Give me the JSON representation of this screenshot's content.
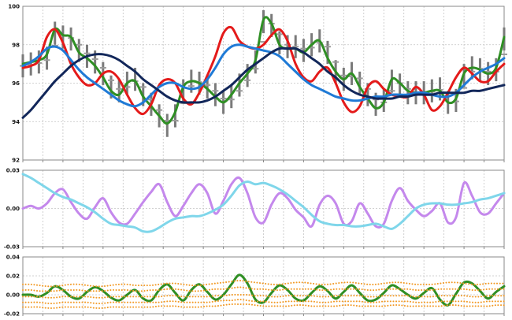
{
  "chart_data": [
    {
      "type": "line",
      "title": "",
      "xlabel": "",
      "ylabel": "",
      "ylim": [
        92,
        100
      ],
      "yticks": [
        92,
        94,
        96,
        98,
        100
      ],
      "ytick_labels": [
        "92",
        "94",
        "96",
        "98",
        "100"
      ],
      "grid": true,
      "x_points": 61,
      "series": [
        {
          "kind": "candles",
          "color": "#7a7a7a",
          "values": [
            96.9,
            97.0,
            97.1,
            97.3,
            98.6,
            98.4,
            98.3,
            97.7,
            97.4,
            97.1,
            96.5,
            95.8,
            95.6,
            96.0,
            96.2,
            95.4,
            94.9,
            94.3,
            93.8,
            94.3,
            95.6,
            96.1,
            96.0,
            95.8,
            95.4,
            95.0,
            95.3,
            95.9,
            96.4,
            97.1,
            99.2,
            99.0,
            98.1,
            97.9,
            97.9,
            97.7,
            98.0,
            98.2,
            97.6,
            96.6,
            96.2,
            96.5,
            96.0,
            95.4,
            94.9,
            95.1,
            96.1,
            95.9,
            95.5,
            95.5,
            95.5,
            95.6,
            95.7,
            95.0,
            95.1,
            96.4,
            96.8,
            96.7,
            96.5,
            96.7,
            98.3
          ],
          "spread": 0.6
        },
        {
          "color": "#2f8f24",
          "values": [
            97.0,
            97.1,
            97.2,
            97.5,
            98.8,
            98.5,
            98.4,
            97.6,
            97.3,
            96.9,
            96.3,
            95.6,
            95.4,
            96.0,
            96.1,
            95.3,
            94.8,
            94.3,
            93.9,
            94.5,
            95.8,
            96.1,
            96.0,
            95.7,
            95.3,
            95.0,
            95.4,
            96.0,
            96.5,
            97.2,
            99.3,
            99.1,
            98.0,
            97.8,
            97.8,
            97.6,
            98.0,
            98.2,
            97.3,
            96.6,
            96.2,
            96.5,
            95.8,
            95.2,
            94.7,
            95.0,
            96.2,
            96.0,
            95.6,
            95.5,
            95.5,
            95.6,
            95.6,
            95.0,
            95.2,
            96.5,
            96.8,
            96.7,
            96.5,
            96.8,
            98.4
          ]
        },
        {
          "color": "#e41a1a",
          "values": [
            96.8,
            96.9,
            97.2,
            98.4,
            98.8,
            98.1,
            97.0,
            96.3,
            95.9,
            96.0,
            96.5,
            96.6,
            96.2,
            95.4,
            94.7,
            94.4,
            94.9,
            95.9,
            96.2,
            96.0,
            95.2,
            94.9,
            95.5,
            96.4,
            97.4,
            98.6,
            98.9,
            98.2,
            97.9,
            97.8,
            98.0,
            98.5,
            98.8,
            98.2,
            97.0,
            96.3,
            96.1,
            96.6,
            96.8,
            96.0,
            95.0,
            94.5,
            94.8,
            95.8,
            96.1,
            95.7,
            95.4,
            95.3,
            95.3,
            95.8,
            95.4,
            94.6,
            94.8,
            95.5,
            96.3,
            96.8,
            96.5,
            96.1,
            96.1,
            96.6,
            97.0
          ]
        },
        {
          "color": "#1f7ad6",
          "values": [
            96.9,
            97.1,
            97.4,
            97.8,
            97.9,
            97.7,
            97.2,
            96.7,
            96.3,
            96.0,
            95.7,
            95.4,
            95.1,
            94.9,
            94.8,
            95.0,
            95.4,
            95.8,
            96.0,
            96.0,
            95.8,
            95.7,
            95.8,
            96.2,
            96.8,
            97.5,
            97.9,
            98.0,
            97.9,
            97.8,
            97.7,
            97.6,
            97.4,
            97.0,
            96.6,
            96.2,
            95.9,
            95.7,
            95.5,
            95.3,
            95.2,
            95.1,
            95.1,
            95.2,
            95.3,
            95.3,
            95.4,
            95.4,
            95.4,
            95.5,
            95.5,
            95.4,
            95.3,
            95.3,
            95.5,
            95.9,
            96.3,
            96.6,
            96.8,
            97.0,
            97.3
          ]
        },
        {
          "color": "#12275a",
          "values": [
            94.2,
            94.6,
            95.1,
            95.6,
            96.1,
            96.5,
            96.9,
            97.2,
            97.4,
            97.5,
            97.5,
            97.4,
            97.2,
            96.9,
            96.6,
            96.2,
            95.9,
            95.6,
            95.3,
            95.1,
            95.0,
            95.0,
            95.0,
            95.1,
            95.3,
            95.6,
            95.9,
            96.3,
            96.7,
            97.0,
            97.3,
            97.6,
            97.8,
            97.8,
            97.8,
            97.6,
            97.3,
            97.0,
            96.6,
            96.3,
            95.9,
            95.6,
            95.4,
            95.3,
            95.2,
            95.2,
            95.2,
            95.3,
            95.3,
            95.4,
            95.4,
            95.4,
            95.5,
            95.5,
            95.5,
            95.5,
            95.6,
            95.6,
            95.7,
            95.8,
            95.9
          ]
        }
      ]
    },
    {
      "type": "line",
      "title": "",
      "ylim": [
        -0.03,
        0.03
      ],
      "yticks": [
        -0.03,
        0,
        0.03
      ],
      "ytick_labels": [
        "-0.03",
        "0.00",
        "0.03"
      ],
      "grid": true,
      "x_points": 61,
      "series": [
        {
          "color": "#c488ec",
          "values": [
            0.0,
            0.002,
            0.0,
            0.004,
            0.012,
            0.015,
            0.005,
            -0.004,
            -0.008,
            0.001,
            0.008,
            -0.003,
            -0.011,
            -0.012,
            -0.004,
            0.005,
            0.013,
            0.019,
            0.005,
            -0.006,
            0.002,
            0.012,
            0.019,
            0.012,
            -0.004,
            0.006,
            0.019,
            0.024,
            0.012,
            -0.007,
            -0.011,
            0.003,
            0.012,
            0.008,
            -0.001,
            -0.007,
            -0.014,
            0.003,
            0.01,
            0.004,
            -0.012,
            -0.01,
            0.004,
            -0.004,
            -0.014,
            -0.012,
            0.006,
            0.016,
            0.006,
            -0.001,
            -0.006,
            -0.002,
            0.004,
            -0.011,
            -0.007,
            0.02,
            0.01,
            -0.003,
            -0.004,
            0.004,
            0.012
          ]
        },
        {
          "color": "#7fd6ea",
          "values": [
            0.027,
            0.024,
            0.02,
            0.016,
            0.012,
            0.009,
            0.007,
            0.004,
            0.001,
            -0.003,
            -0.008,
            -0.012,
            -0.013,
            -0.014,
            -0.015,
            -0.018,
            -0.018,
            -0.015,
            -0.011,
            -0.008,
            -0.007,
            -0.006,
            -0.006,
            -0.004,
            -0.001,
            0.003,
            0.01,
            0.018,
            0.021,
            0.019,
            0.02,
            0.018,
            0.015,
            0.011,
            0.006,
            0.001,
            -0.005,
            -0.01,
            -0.012,
            -0.013,
            -0.013,
            -0.014,
            -0.014,
            -0.013,
            -0.012,
            -0.014,
            -0.016,
            -0.012,
            -0.006,
            0.0,
            0.003,
            0.004,
            0.004,
            0.003,
            0.003,
            0.004,
            0.005,
            0.007,
            0.008,
            0.01,
            0.012
          ]
        }
      ]
    },
    {
      "type": "line",
      "title": "",
      "ylim": [
        -0.02,
        0.04
      ],
      "yticks": [
        -0.02,
        0,
        0.02,
        0.04
      ],
      "ytick_labels": [
        "-0.02",
        "0.00",
        "0.02",
        "0.04"
      ],
      "grid": true,
      "x_points": 61,
      "series": [
        {
          "color": "#2f8f24",
          "values": [
            0.0,
            0.0,
            -0.002,
            0.002,
            0.009,
            0.005,
            -0.002,
            -0.004,
            0.003,
            0.008,
            0.004,
            -0.003,
            -0.006,
            0.0,
            0.005,
            -0.004,
            -0.006,
            0.005,
            0.011,
            0.002,
            -0.006,
            0.005,
            0.011,
            0.003,
            -0.005,
            0.0,
            0.011,
            0.021,
            0.012,
            -0.005,
            -0.008,
            0.002,
            0.01,
            0.005,
            -0.004,
            -0.006,
            0.002,
            0.009,
            0.004,
            -0.004,
            0.003,
            0.01,
            0.002,
            -0.006,
            -0.005,
            0.002,
            0.01,
            0.006,
            0.0,
            -0.004,
            0.002,
            0.007,
            -0.005,
            -0.011,
            0.001,
            0.013,
            0.012,
            0.004,
            -0.004,
            0.003,
            0.009
          ]
        },
        {
          "color": "#f29a26",
          "dotted": true,
          "values": [
            0.011,
            0.011,
            0.01,
            0.009,
            0.009,
            0.01,
            0.011,
            0.011,
            0.01,
            0.009,
            0.009,
            0.01,
            0.011,
            0.011,
            0.01,
            0.01,
            0.01,
            0.011,
            0.012,
            0.012,
            0.011,
            0.01,
            0.01,
            0.011,
            0.012,
            0.013,
            0.014,
            0.015,
            0.014,
            0.013,
            0.012,
            0.011,
            0.011,
            0.012,
            0.013,
            0.013,
            0.012,
            0.011,
            0.011,
            0.012,
            0.013,
            0.013,
            0.012,
            0.011,
            0.011,
            0.012,
            0.013,
            0.013,
            0.012,
            0.011,
            0.011,
            0.011,
            0.012,
            0.013,
            0.013,
            0.012,
            0.011,
            0.011,
            0.012,
            0.012,
            0.012
          ]
        },
        {
          "color": "#f29a26",
          "dotted": true,
          "values": [
            0.005,
            0.005,
            0.004,
            0.004,
            0.004,
            0.005,
            0.005,
            0.005,
            0.004,
            0.004,
            0.004,
            0.005,
            0.005,
            0.005,
            0.004,
            0.004,
            0.005,
            0.005,
            0.006,
            0.006,
            0.005,
            0.004,
            0.004,
            0.005,
            0.006,
            0.006,
            0.007,
            0.008,
            0.007,
            0.006,
            0.006,
            0.005,
            0.005,
            0.006,
            0.006,
            0.006,
            0.006,
            0.005,
            0.005,
            0.006,
            0.006,
            0.006,
            0.006,
            0.005,
            0.005,
            0.006,
            0.006,
            0.006,
            0.006,
            0.005,
            0.005,
            0.005,
            0.006,
            0.006,
            0.006,
            0.006,
            0.005,
            0.005,
            0.006,
            0.006,
            0.006
          ]
        },
        {
          "color": "#f29a26",
          "dotted": true,
          "values": [
            -0.002,
            -0.002,
            -0.002,
            -0.003,
            -0.003,
            -0.002,
            -0.002,
            -0.002,
            -0.002,
            -0.003,
            -0.003,
            -0.002,
            -0.002,
            -0.002,
            -0.002,
            -0.002,
            -0.002,
            -0.002,
            -0.001,
            -0.001,
            -0.002,
            -0.002,
            -0.002,
            -0.002,
            -0.001,
            -0.001,
            0.0,
            0.0,
            0.0,
            -0.001,
            -0.001,
            -0.002,
            -0.002,
            -0.001,
            -0.001,
            -0.001,
            -0.001,
            -0.002,
            -0.002,
            -0.001,
            -0.001,
            -0.001,
            -0.001,
            -0.002,
            -0.002,
            -0.001,
            -0.001,
            -0.001,
            -0.001,
            -0.002,
            -0.002,
            -0.002,
            -0.001,
            -0.001,
            -0.001,
            -0.001,
            -0.002,
            -0.002,
            -0.001,
            -0.001,
            -0.001
          ]
        },
        {
          "color": "#f29a26",
          "dotted": true,
          "values": [
            -0.008,
            -0.008,
            -0.008,
            -0.009,
            -0.009,
            -0.008,
            -0.008,
            -0.008,
            -0.008,
            -0.009,
            -0.009,
            -0.008,
            -0.008,
            -0.008,
            -0.008,
            -0.008,
            -0.008,
            -0.008,
            -0.007,
            -0.007,
            -0.008,
            -0.008,
            -0.008,
            -0.008,
            -0.007,
            -0.006,
            -0.006,
            -0.005,
            -0.006,
            -0.007,
            -0.007,
            -0.008,
            -0.008,
            -0.007,
            -0.007,
            -0.007,
            -0.007,
            -0.008,
            -0.008,
            -0.007,
            -0.007,
            -0.007,
            -0.007,
            -0.008,
            -0.008,
            -0.007,
            -0.007,
            -0.007,
            -0.007,
            -0.008,
            -0.008,
            -0.008,
            -0.007,
            -0.007,
            -0.007,
            -0.007,
            -0.008,
            -0.008,
            -0.007,
            -0.007,
            -0.007
          ]
        },
        {
          "color": "#f29a26",
          "dotted": true,
          "values": [
            -0.013,
            -0.013,
            -0.013,
            -0.014,
            -0.014,
            -0.013,
            -0.013,
            -0.013,
            -0.013,
            -0.014,
            -0.014,
            -0.013,
            -0.013,
            -0.013,
            -0.013,
            -0.013,
            -0.013,
            -0.012,
            -0.012,
            -0.012,
            -0.013,
            -0.013,
            -0.013,
            -0.012,
            -0.012,
            -0.011,
            -0.01,
            -0.01,
            -0.01,
            -0.011,
            -0.012,
            -0.012,
            -0.012,
            -0.012,
            -0.011,
            -0.011,
            -0.012,
            -0.012,
            -0.012,
            -0.012,
            -0.011,
            -0.011,
            -0.012,
            -0.012,
            -0.012,
            -0.012,
            -0.011,
            -0.011,
            -0.012,
            -0.012,
            -0.012,
            -0.012,
            -0.012,
            -0.011,
            -0.011,
            -0.012,
            -0.012,
            -0.012,
            -0.012,
            -0.011,
            -0.011
          ]
        }
      ]
    }
  ]
}
